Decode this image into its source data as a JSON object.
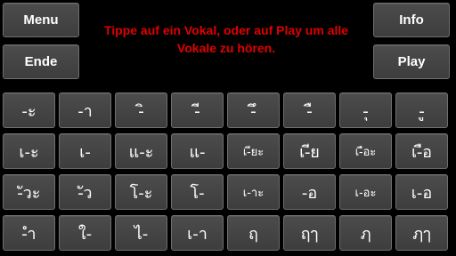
{
  "buttons": {
    "menu": "Menu",
    "end": "Ende",
    "info": "Info",
    "play": "Play"
  },
  "instruction": "Tippe auf ein Vokal, oder auf Play um alle Vokale zu hören.",
  "colors": {
    "instruction": "#e00000",
    "button_bg": "#444444",
    "background": "#000000"
  },
  "vowels": [
    [
      "-ะ",
      "-า",
      "-ิ",
      "-ี",
      "-ึ",
      "-ื",
      "-ุ",
      "-ู"
    ],
    [
      "เ-ะ",
      "เ-",
      "แ-ะ",
      "แ-",
      "เ-ียะ",
      "เ-ีย",
      "เ-ือะ",
      "เ-ือ"
    ],
    [
      "-ัวะ",
      "-ัว",
      "โ-ะ",
      "โ-",
      "เ-าะ",
      "-อ",
      "เ-อะ",
      "เ-อ"
    ],
    [
      "-ำ",
      "ใ-",
      "ไ-",
      "เ-า",
      "ฤ",
      "ฤๅ",
      "ฦ",
      "ฦๅ"
    ]
  ]
}
